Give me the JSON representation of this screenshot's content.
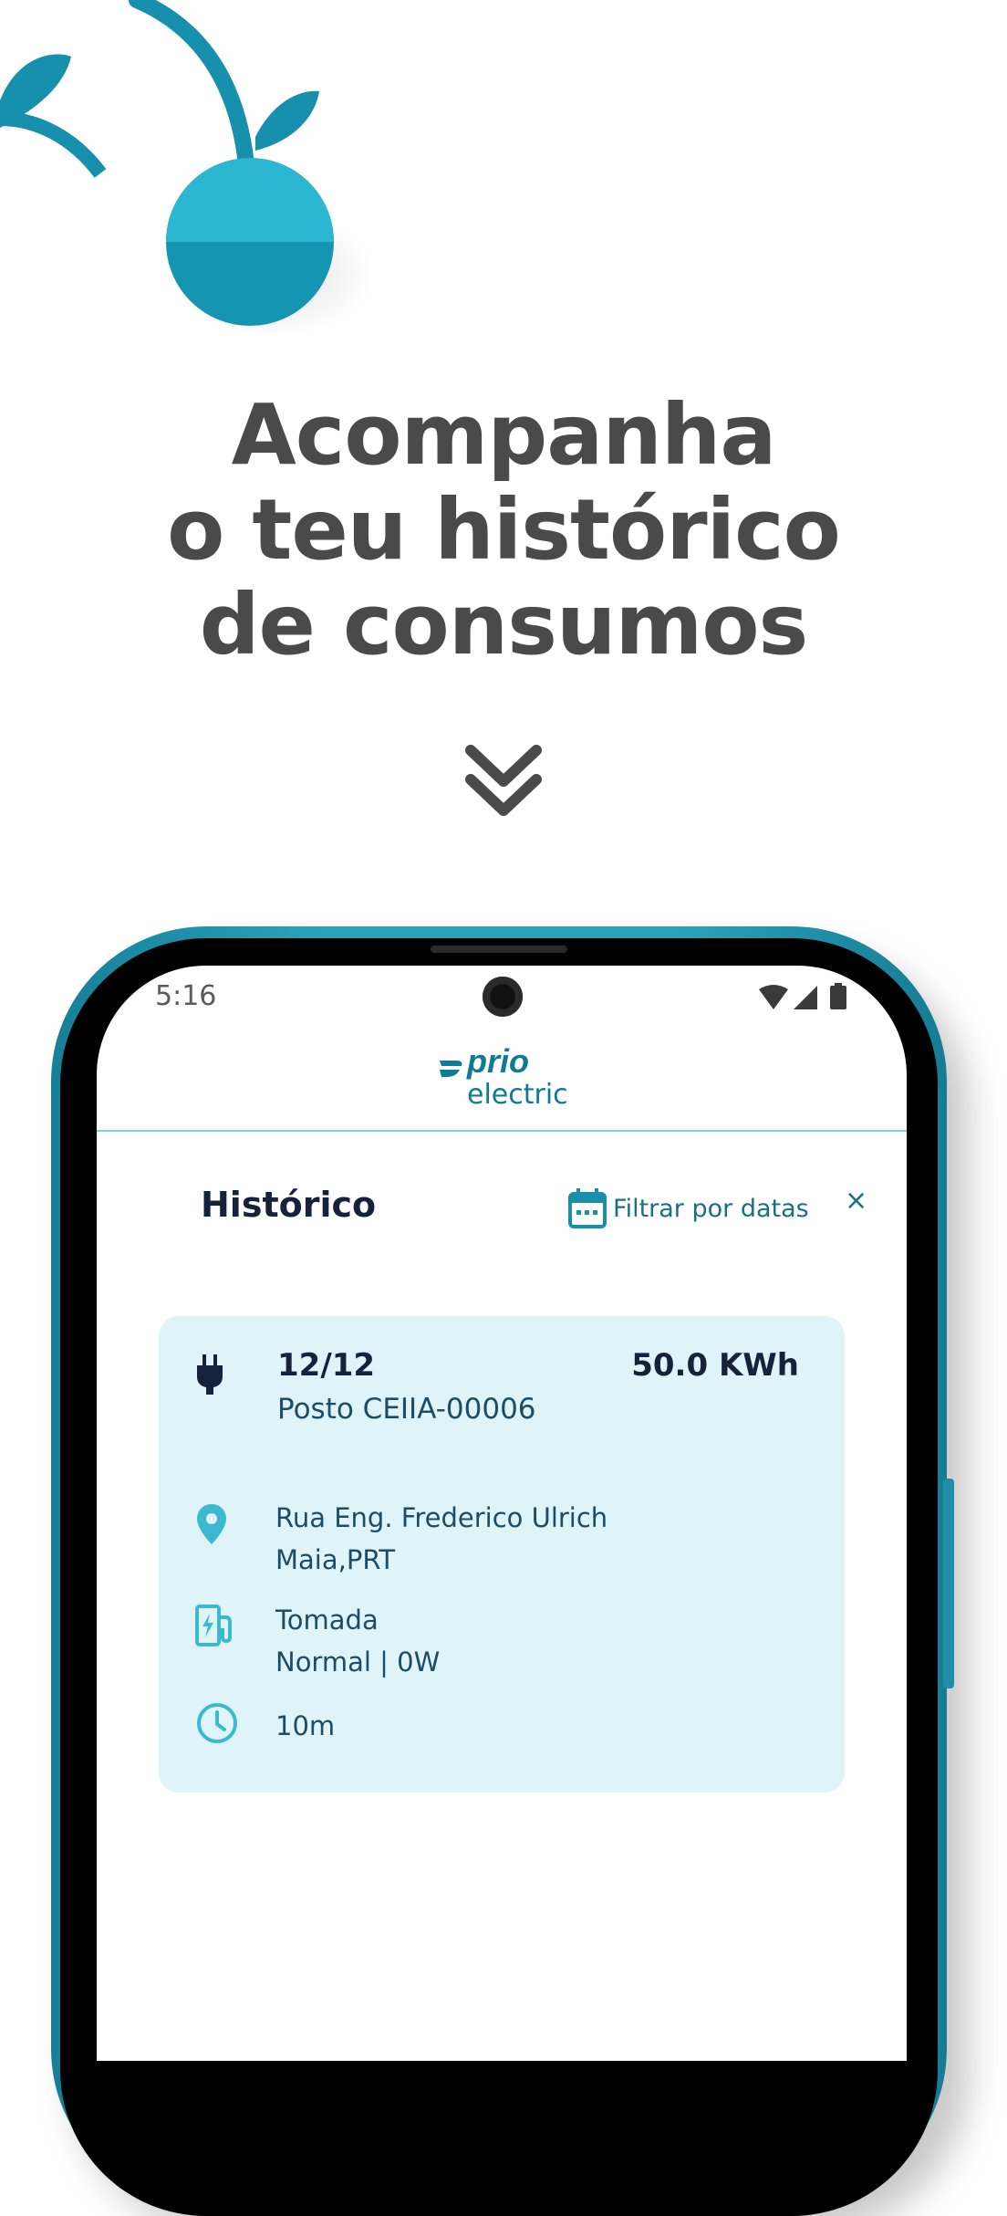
{
  "headline": {
    "line1": "Acompanha",
    "line2": "o teu histórico",
    "line3": "de consumos"
  },
  "colors": {
    "accent": "#1a9bb6",
    "text_dark": "#16213b",
    "headline": "#4a4a4a",
    "card_bg": "#dff4f8"
  },
  "status_bar": {
    "time": "5:16"
  },
  "app": {
    "logo_top": "prio",
    "logo_bottom": "electric"
  },
  "history": {
    "title": "Histórico",
    "filter_label": "Filtrar por datas",
    "close_symbol": "×"
  },
  "entry": {
    "date": "12/12",
    "energy": "50.0 KWh",
    "station": "Posto CEIIA-00006",
    "address_line1": "Rua Eng. Frederico Ulrich",
    "address_line2": "Maia,PRT",
    "socket_line1": "Tomada",
    "socket_line2": "Normal | 0W",
    "duration": "10m",
    "icons": [
      "plug-icon",
      "location-pin-icon",
      "charging-station-icon",
      "clock-icon"
    ]
  }
}
